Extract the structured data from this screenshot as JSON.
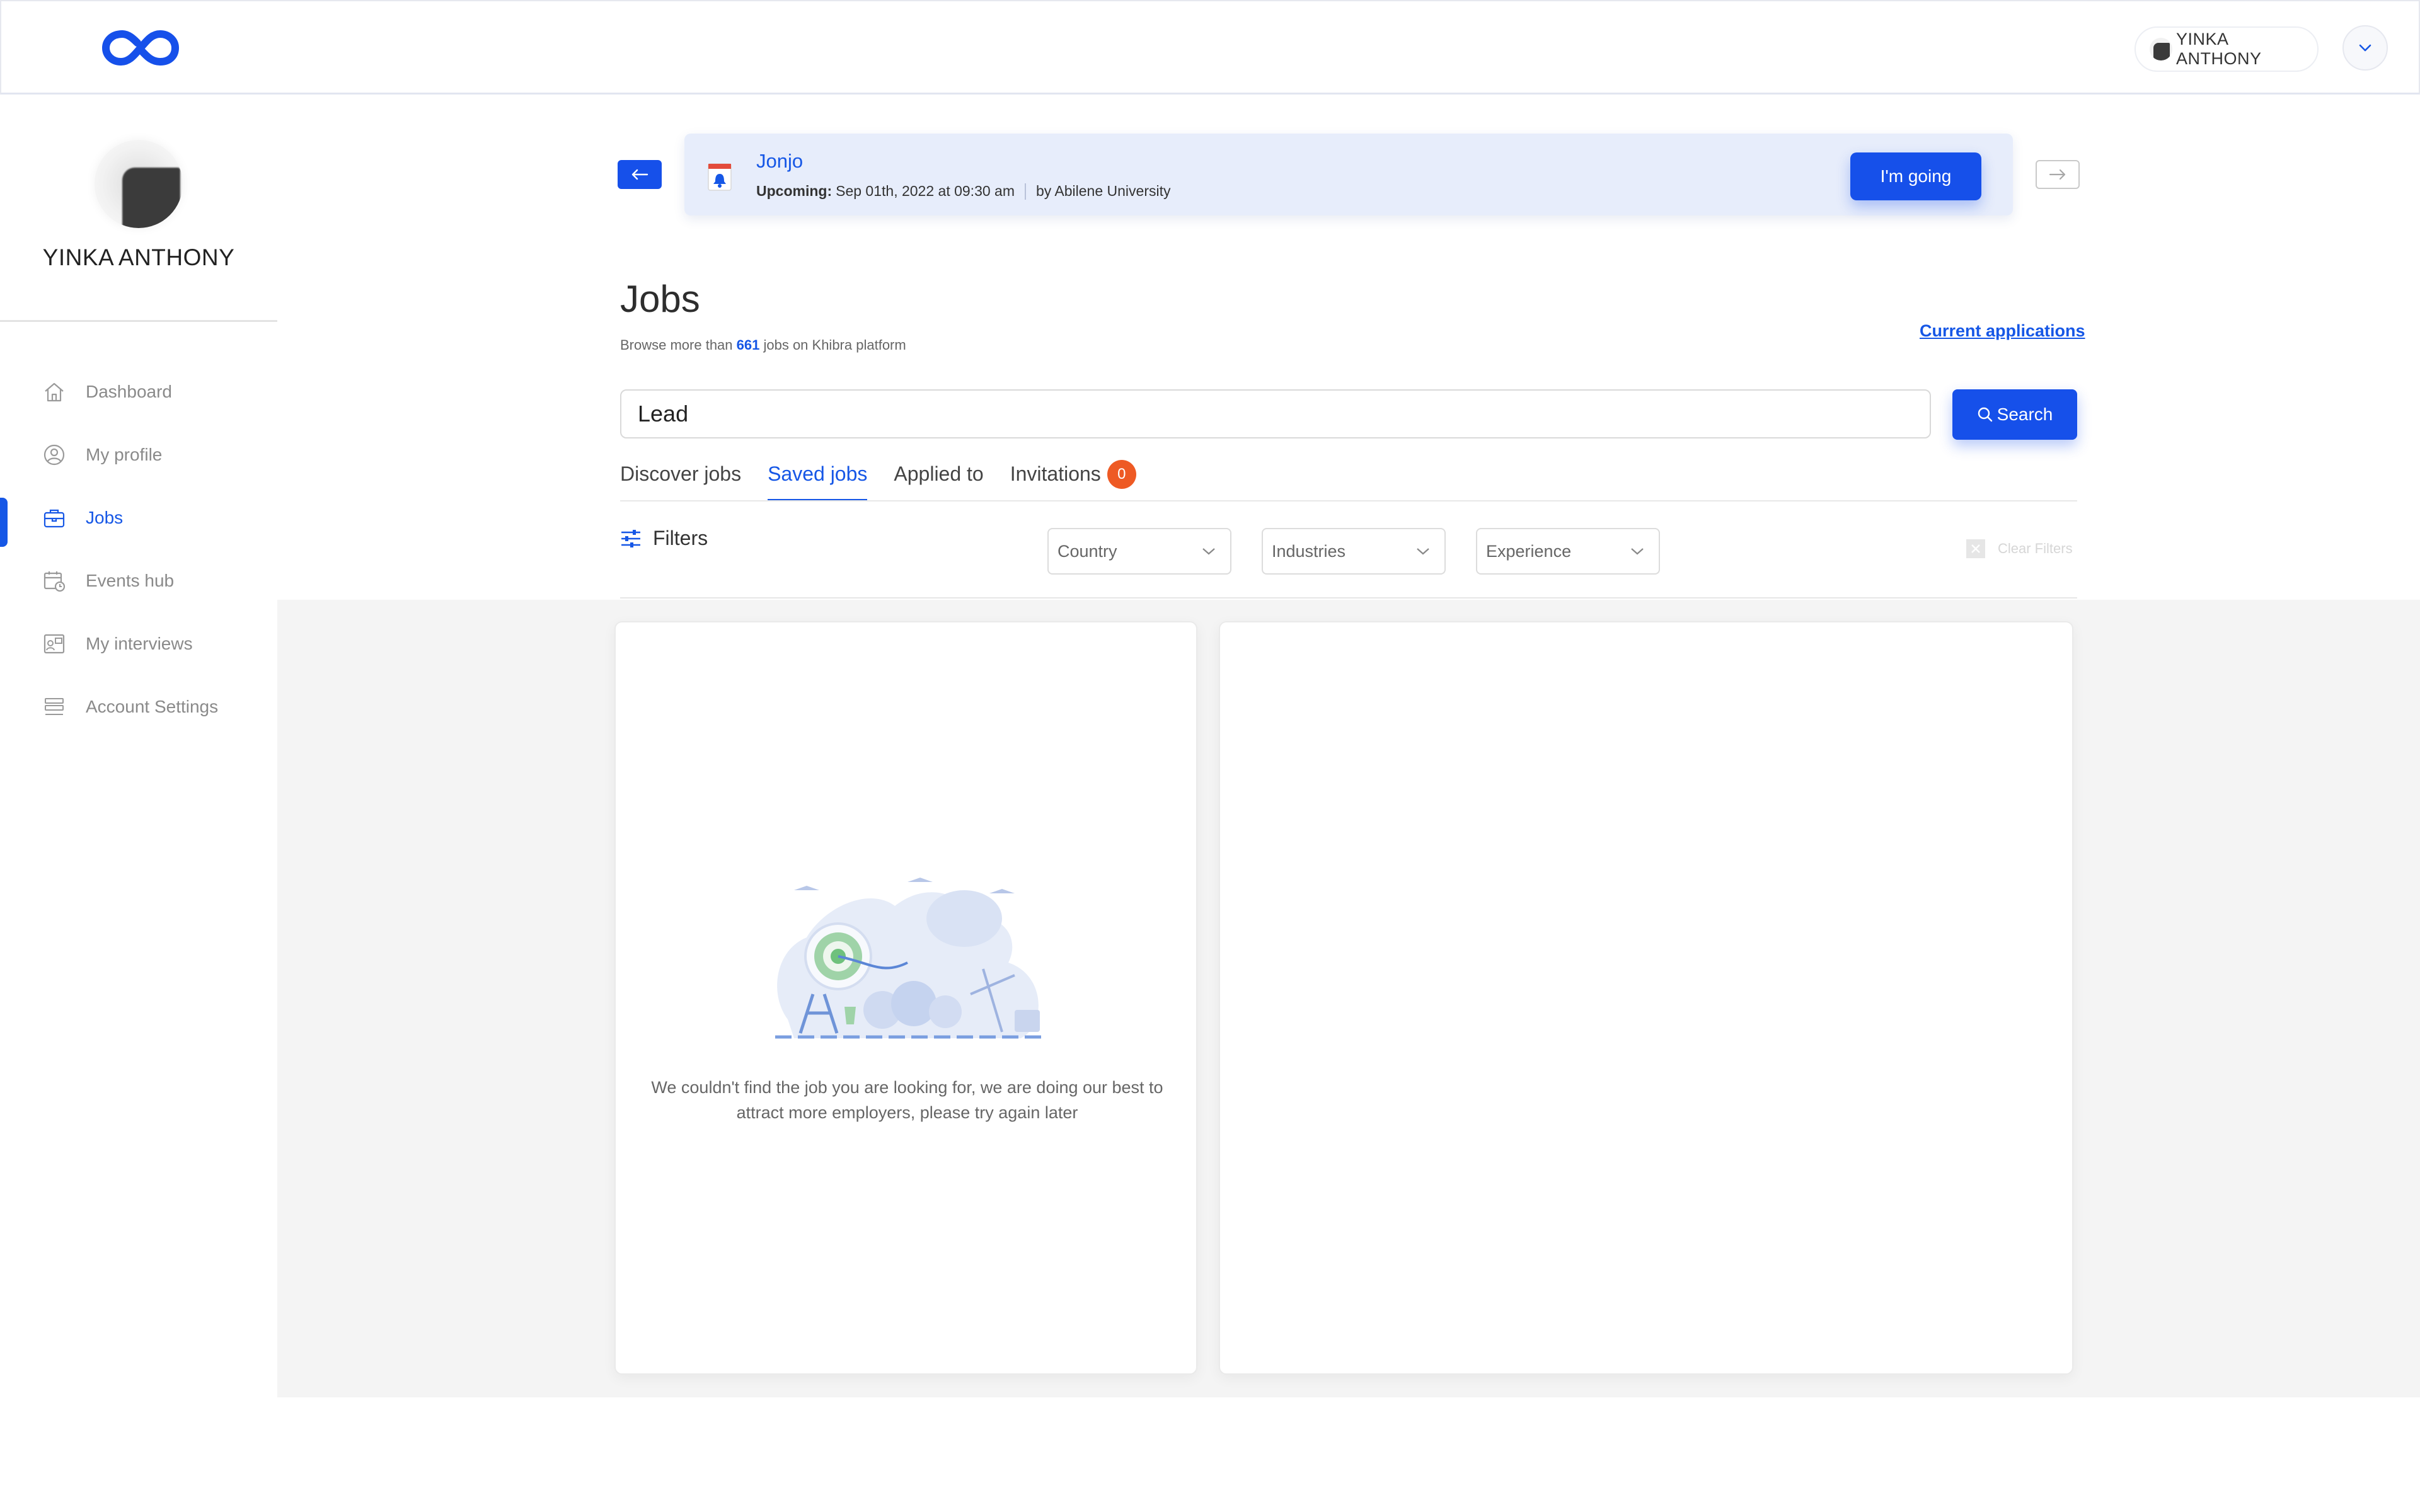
{
  "header": {
    "user_name": "YINKA ANTHONY"
  },
  "sidebar": {
    "profile_name": "YINKA ANTHONY",
    "items": [
      {
        "label": "Dashboard",
        "icon": "home-icon"
      },
      {
        "label": "My profile",
        "icon": "user-circle-icon"
      },
      {
        "label": "Jobs",
        "icon": "briefcase-icon",
        "active": true
      },
      {
        "label": "Events hub",
        "icon": "calendar-clock-icon"
      },
      {
        "label": "My interviews",
        "icon": "interview-icon"
      },
      {
        "label": "Account Settings",
        "icon": "settings-list-icon"
      }
    ]
  },
  "event": {
    "title": "Jonjo",
    "upcoming_label": "Upcoming:",
    "date": "Sep 01th, 2022 at 09:30 am",
    "by": "by Abilene University",
    "going_label": "I'm going"
  },
  "jobs": {
    "title": "Jobs",
    "subtitle_pre": "Browse more than ",
    "count": "661",
    "subtitle_post": " jobs on Khibra platform",
    "current_applications": "Current applications"
  },
  "search": {
    "value": "Lead",
    "button_label": "Search"
  },
  "tabs": [
    {
      "label": "Discover jobs"
    },
    {
      "label": "Saved jobs",
      "active": true
    },
    {
      "label": "Applied to"
    },
    {
      "label": "Invitations",
      "badge": "0"
    }
  ],
  "filters": {
    "label": "Filters",
    "country": "Country",
    "industries": "Industries",
    "experience": "Experience",
    "clear": "Clear Filters"
  },
  "empty_state": {
    "message": "We couldn't find the job you are looking for, we are doing our best to attract more employers, please try again later"
  },
  "colors": {
    "brand": "#1650ea",
    "badge": "#ee5a24",
    "banner_bg": "#e7edfb",
    "grey_bg": "#f4f4f4"
  }
}
